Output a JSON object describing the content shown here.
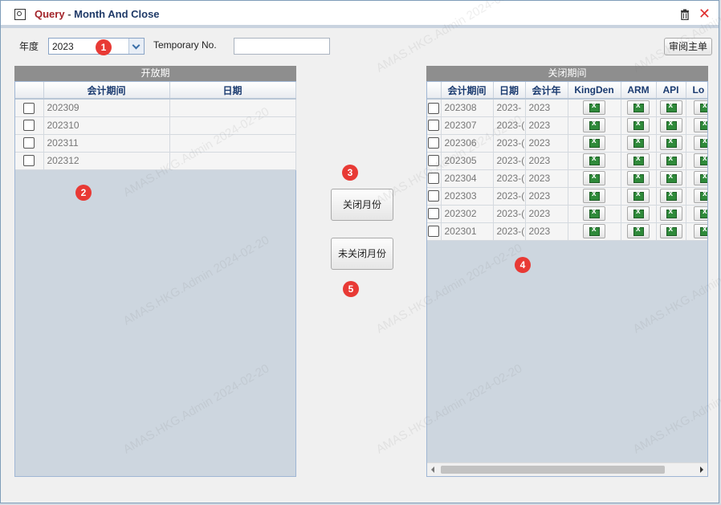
{
  "window": {
    "title_query": "Query",
    "title_sep": " - ",
    "title_main": "Month And Close"
  },
  "toolbar": {
    "year_label": "年度",
    "year_value": "2023",
    "temp_label": "Temporary No.",
    "temp_value": "",
    "review_button": "审阅主单"
  },
  "open_panel": {
    "header": "开放期",
    "columns": [
      "会计期间",
      "日期"
    ],
    "rows": [
      {
        "period": "202309",
        "date": ""
      },
      {
        "period": "202310",
        "date": ""
      },
      {
        "period": "202311",
        "date": ""
      },
      {
        "period": "202312",
        "date": ""
      }
    ]
  },
  "actions": {
    "close_month": "关闭月份",
    "unclose_month": "未关闭月份"
  },
  "closed_panel": {
    "header": "关闭期间",
    "columns": [
      "会计期间",
      "日期",
      "会计年",
      "KingDen",
      "ARM",
      "API",
      "Lo"
    ],
    "rows": [
      {
        "period": "202308",
        "date": "2023-",
        "year": "2023"
      },
      {
        "period": "202307",
        "date": "2023-(",
        "year": "2023"
      },
      {
        "period": "202306",
        "date": "2023-(",
        "year": "2023"
      },
      {
        "period": "202305",
        "date": "2023-(",
        "year": "2023"
      },
      {
        "period": "202304",
        "date": "2023-(",
        "year": "2023"
      },
      {
        "period": "202303",
        "date": "2023-(",
        "year": "2023"
      },
      {
        "period": "202302",
        "date": "2023-(",
        "year": "2023"
      },
      {
        "period": "202301",
        "date": "2023-(",
        "year": "2023"
      }
    ]
  },
  "markers": [
    "1",
    "2",
    "3",
    "4",
    "5"
  ],
  "watermark": "AMAS.HKG.Admin 2024-02-20",
  "icons": {
    "title": "magnifier-icon",
    "trash": "trash-icon",
    "close": "close-icon",
    "excel": "excel-icon"
  },
  "colors": {
    "title_query": "#a3242a",
    "title_main": "#1f3a68",
    "marker": "#e83a35",
    "panel_header": "#8e8e8e"
  }
}
